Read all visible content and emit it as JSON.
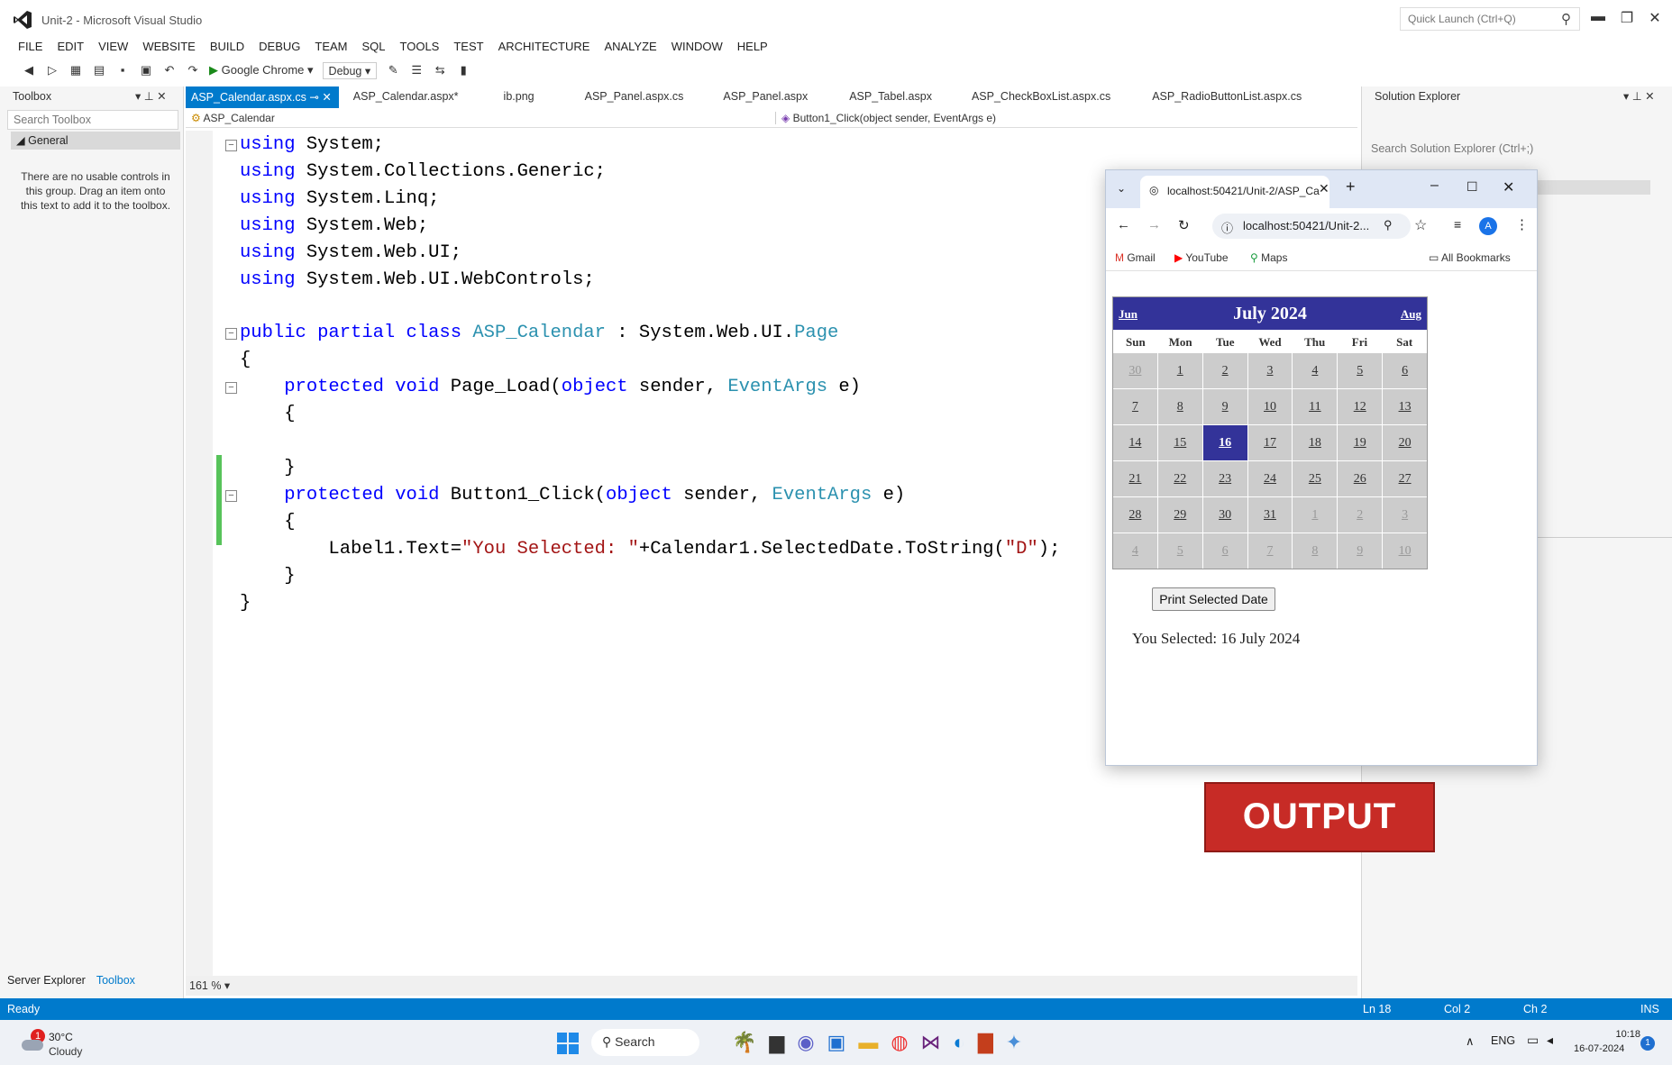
{
  "window": {
    "title": "Unit-2 - Microsoft Visual Studio",
    "quick_launch_placeholder": "Quick Launch (Ctrl+Q)"
  },
  "menu": [
    "FILE",
    "EDIT",
    "VIEW",
    "WEBSITE",
    "BUILD",
    "DEBUG",
    "TEAM",
    "SQL",
    "TOOLS",
    "TEST",
    "ARCHITECTURE",
    "ANALYZE",
    "WINDOW",
    "HELP"
  ],
  "toolbar": {
    "run_target": "Google Chrome",
    "config": "Debug"
  },
  "toolbox": {
    "title": "Toolbox",
    "search_placeholder": "Search Toolbox",
    "group": "General",
    "empty_message": "There are no usable controls in this group. Drag an item onto this text to add it to the toolbox.",
    "bottom_tabs": [
      "Server Explorer",
      "Toolbox"
    ]
  },
  "doc_tabs": [
    {
      "label": "ASP_Calendar.aspx.cs",
      "active": true
    },
    {
      "label": "ASP_Calendar.aspx*"
    },
    {
      "label": "ib.png"
    },
    {
      "label": "ASP_Panel.aspx.cs"
    },
    {
      "label": "ASP_Panel.aspx"
    },
    {
      "label": "ASP_Tabel.aspx"
    },
    {
      "label": "ASP_CheckBoxList.aspx.cs"
    },
    {
      "label": "ASP_RadioButtonList.aspx.cs"
    }
  ],
  "nav": {
    "class_dropdown": "ASP_Calendar",
    "member_dropdown": "Button1_Click(object sender, EventArgs e)"
  },
  "code": {
    "using1": "System;",
    "using2": "System.Collections.Generic;",
    "using3": "System.Linq;",
    "using4": "System.Web;",
    "using5": "System.Web.UI;",
    "using6": "System.Web.UI.WebControls;",
    "class_name": "ASP_Calendar",
    "base_ns": "System.Web.UI.",
    "base_type": "Page",
    "method1": "Page_Load",
    "method2": "Button1_Click",
    "event_type": "EventArgs",
    "body_pre": "Label1.Text=",
    "body_str": "\"You Selected: \"",
    "body_mid": "+Calendar1.SelectedDate.ToString(",
    "body_str2": "\"D\"",
    "body_post": ");"
  },
  "solution_explorer": {
    "title": "Solution Explorer",
    "search_placeholder": "Search Solution Explorer (Ctrl+;)"
  },
  "zoom": "161 %",
  "status": {
    "state": "Ready",
    "ln": "Ln 18",
    "col": "Col 2",
    "ch": "Ch 2",
    "mode": "INS"
  },
  "browser": {
    "tab_title": "localhost:50421/Unit-2/ASP_Ca",
    "url": "localhost:50421/Unit-2...",
    "bookmarks": [
      "Gmail",
      "YouTube",
      "Maps"
    ],
    "all_bookmarks": "All Bookmarks",
    "profile_initial": "A"
  },
  "calendar": {
    "prev": "Jun",
    "title": "July 2024",
    "next": "Aug",
    "weekdays": [
      "Sun",
      "Mon",
      "Tue",
      "Wed",
      "Thu",
      "Fri",
      "Sat"
    ],
    "days": [
      "30",
      "1",
      "2",
      "3",
      "4",
      "5",
      "6",
      "7",
      "8",
      "9",
      "10",
      "11",
      "12",
      "13",
      "14",
      "15",
      "16",
      "17",
      "18",
      "19",
      "20",
      "21",
      "22",
      "23",
      "24",
      "25",
      "26",
      "27",
      "28",
      "29",
      "30",
      "31",
      "1",
      "2",
      "3",
      "4",
      "5",
      "6",
      "7",
      "8",
      "9",
      "10"
    ],
    "other_month_index": [
      0,
      32,
      33,
      34,
      35,
      36,
      37,
      38,
      39,
      40,
      41
    ],
    "selected_index": 16
  },
  "page": {
    "button_label": "Print Selected Date",
    "result": "You Selected: 16 July 2024"
  },
  "badge": "OUTPUT",
  "taskbar": {
    "weather_temp": "30°C",
    "weather_desc": "Cloudy",
    "search": "Search",
    "lang": "ENG",
    "time": "10:18",
    "date": "16-07-2024",
    "notif_badge": "1",
    "weather_badge": "1"
  }
}
